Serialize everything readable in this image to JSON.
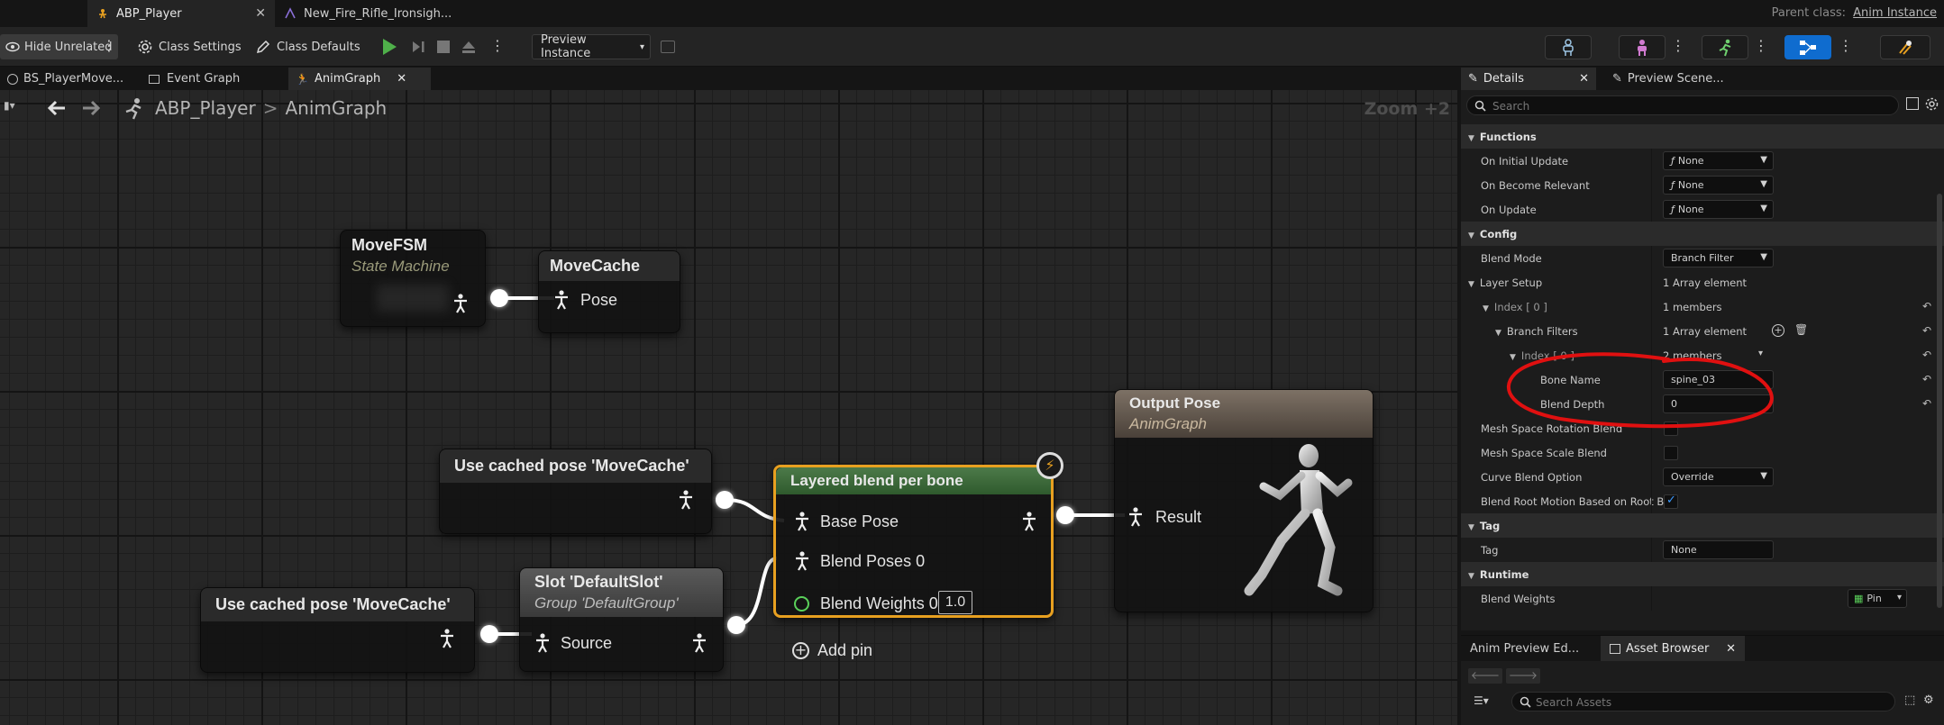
{
  "titlebar": {
    "tabs": [
      {
        "label": "ABP_Player",
        "active": true
      },
      {
        "label": "New_Fire_Rifle_Ironsigh...",
        "active": false
      }
    ],
    "parent_class_label": "Parent class:",
    "parent_class_value": "Anim Instance"
  },
  "toolbar": {
    "hide_unrelated": "Hide Unrelated",
    "class_settings": "Class Settings",
    "class_defaults": "Class Defaults",
    "preview_instance": "Preview Instance"
  },
  "graph_tabs": [
    {
      "label": "BS_PlayerMove...",
      "active": false
    },
    {
      "label": "Event Graph",
      "active": false
    },
    {
      "label": "AnimGraph",
      "active": true
    }
  ],
  "graph": {
    "breadcrumb": [
      "ABP_Player",
      "AnimGraph"
    ],
    "zoom": "Zoom +2",
    "nodes": {
      "movefsm": {
        "title": "MoveFSM",
        "subtitle": "State Machine"
      },
      "movecache": {
        "title": "MoveCache",
        "pin": "Pose"
      },
      "cached1": {
        "title": "Use cached pose 'MoveCache'"
      },
      "cached2": {
        "title": "Use cached pose 'MoveCache'"
      },
      "slot": {
        "title": "Slot 'DefaultSlot'",
        "subtitle": "Group 'DefaultGroup'",
        "pin": "Source"
      },
      "layered": {
        "title": "Layered blend per bone",
        "pins": [
          "Base Pose",
          "Blend Poses 0",
          "Blend Weights 0",
          "Add pin"
        ],
        "weight_value": "1.0"
      },
      "output": {
        "title": "Output Pose",
        "subtitle": "AnimGraph",
        "pin": "Result"
      }
    }
  },
  "details": {
    "tabs": [
      {
        "label": "Details",
        "active": true
      },
      {
        "label": "Preview Scene...",
        "active": false
      }
    ],
    "search_placeholder": "Search",
    "rows": {
      "functions": "Functions",
      "on_initial_update": "On Initial Update",
      "on_become_relevant": "On Become Relevant",
      "on_update": "On Update",
      "none_func": "None",
      "config": "Config",
      "blend_mode": "Blend Mode",
      "blend_mode_value": "Branch Filter",
      "layer_setup": "Layer Setup",
      "layer_setup_value": "1 Array element",
      "index0": "Index [ 0 ]",
      "index0_value": "1 members",
      "branch_filters": "Branch Filters",
      "branch_filters_value": "1 Array element",
      "index0b": "Index [ 0 ]",
      "index0b_value": "2 members",
      "bone_name": "Bone Name",
      "bone_name_value": "spine_03",
      "blend_depth": "Blend Depth",
      "blend_depth_value": "0",
      "mesh_rot": "Mesh Space Rotation Blend",
      "mesh_scale": "Mesh Space Scale Blend",
      "curve_blend": "Curve Blend Option",
      "curve_blend_value": "Override",
      "root_motion": "Blend Root Motion Based on Root B...",
      "tag_cat": "Tag",
      "tag": "Tag",
      "tag_value": "None",
      "runtime": "Runtime",
      "blend_weights": "Blend Weights",
      "blend_weights_value": "Pin"
    }
  },
  "bottom": {
    "tabs": [
      {
        "label": "Anim Preview Ed...",
        "active": false
      },
      {
        "label": "Asset Browser",
        "active": true
      }
    ],
    "search_placeholder": "Search Assets"
  },
  "colors": {
    "accent_blue": "#0f6ccf",
    "highlight_orange": "#e8a020",
    "annotation_red": "#e01010",
    "layered_header": "#3d6b3b",
    "output_header": "#6b5f52"
  }
}
